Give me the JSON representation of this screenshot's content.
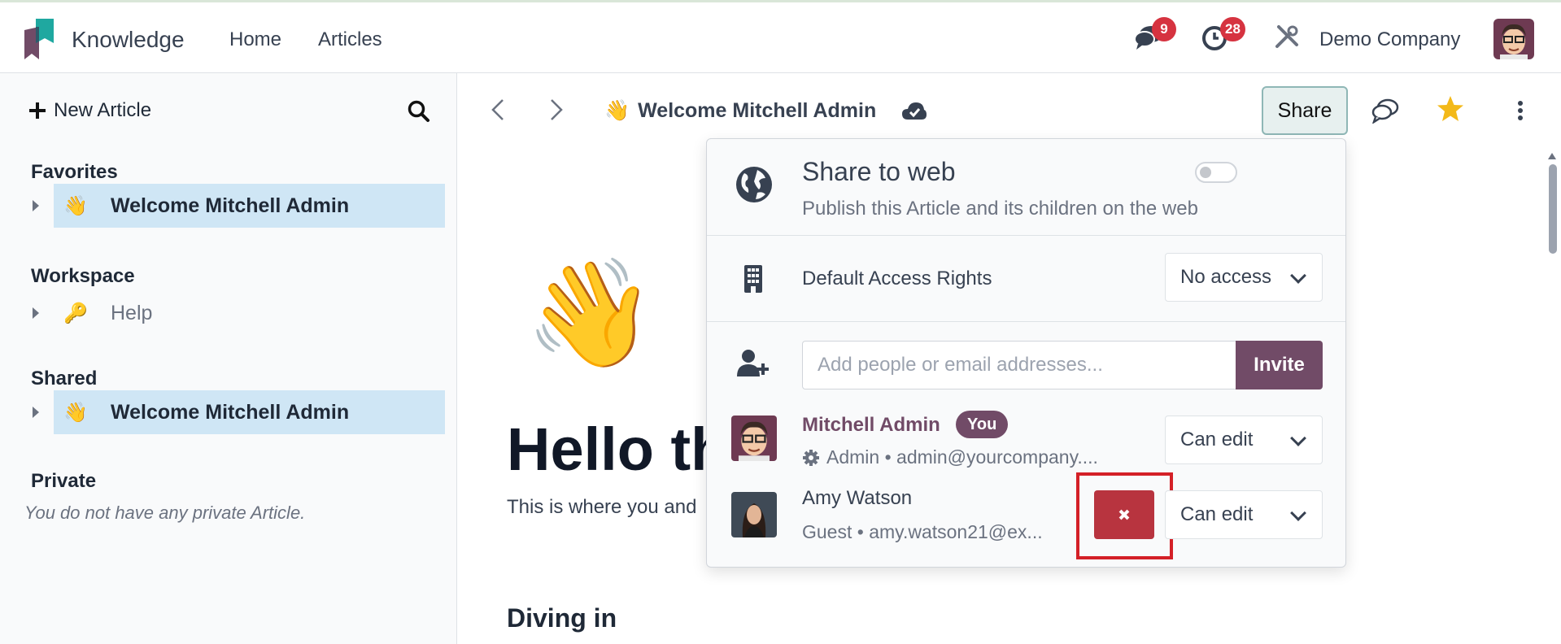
{
  "navbar": {
    "app_name": "Knowledge",
    "links": [
      "Home",
      "Articles"
    ],
    "messages_count": "9",
    "activities_count": "28",
    "company": "Demo Company",
    "brand_colors": {
      "teal": "#1fa8a0",
      "purple": "#714b67",
      "badge": "#d63340"
    }
  },
  "sidebar": {
    "new_article_label": "New Article",
    "favorites": {
      "title": "Favorites",
      "items": [
        {
          "emoji": "👋",
          "label": "Welcome Mitchell Admin"
        }
      ]
    },
    "workspace": {
      "title": "Workspace",
      "items": [
        {
          "emoji": "🔑",
          "label": "Help"
        }
      ]
    },
    "shared": {
      "title": "Shared",
      "items": [
        {
          "emoji": "👋",
          "label": "Welcome Mitchell Admin"
        }
      ]
    },
    "private": {
      "title": "Private",
      "empty_text": "You do not have any private Article."
    }
  },
  "article": {
    "breadcrumb_emoji": "👋",
    "breadcrumb_title": "Welcome Mitchell Admin",
    "share_label": "Share",
    "big_emoji": "👋",
    "heading": "Hello th",
    "intro": "This is where you and",
    "subheading": "Diving in"
  },
  "share_panel": {
    "share_web_title": "Share to web",
    "share_web_subtitle": "Publish this Article and its children on the web",
    "share_web_enabled": false,
    "default_access_label": "Default Access Rights",
    "default_access_value": "No access",
    "invite_placeholder": "Add people or email addresses...",
    "invite_label": "Invite",
    "members": [
      {
        "name": "Mitchell Admin",
        "badge": "You",
        "subtitle": "Admin • admin@yourcompany....",
        "permission": "Can edit"
      },
      {
        "name": "Amy Watson",
        "subtitle": "Guest • amy.watson21@ex...",
        "permission": "Can edit"
      }
    ]
  }
}
